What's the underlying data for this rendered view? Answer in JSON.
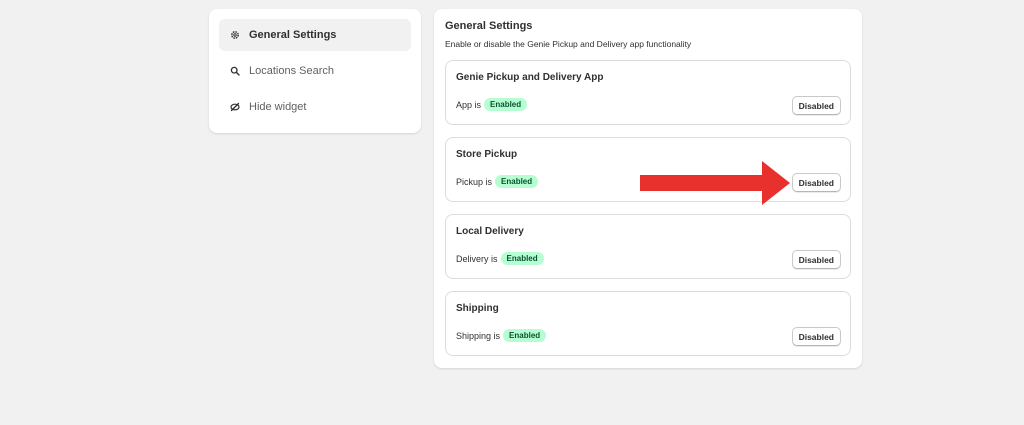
{
  "sidebar": {
    "items": [
      {
        "label": "General Settings",
        "icon": "gear-icon",
        "active": true
      },
      {
        "label": "Locations Search",
        "icon": "search-icon",
        "active": false
      },
      {
        "label": "Hide widget",
        "icon": "hide-icon",
        "active": false
      }
    ]
  },
  "main": {
    "title": "General Settings",
    "subtitle": "Enable or disable the Genie Pickup and Delivery app functionality",
    "cards": [
      {
        "title": "Genie Pickup and Delivery App",
        "status_text": "App is",
        "badge": "Enabled",
        "button": "Disabled"
      },
      {
        "title": "Store Pickup",
        "status_text": "Pickup is",
        "badge": "Enabled",
        "button": "Disabled"
      },
      {
        "title": "Local Delivery",
        "status_text": "Delivery is",
        "badge": "Enabled",
        "button": "Disabled"
      },
      {
        "title": "Shipping",
        "status_text": "Shipping is",
        "badge": "Enabled",
        "button": "Disabled"
      }
    ]
  },
  "colors": {
    "badge_bg": "#b4fed2",
    "badge_text": "#0c5132",
    "arrow": "#e8302c"
  }
}
